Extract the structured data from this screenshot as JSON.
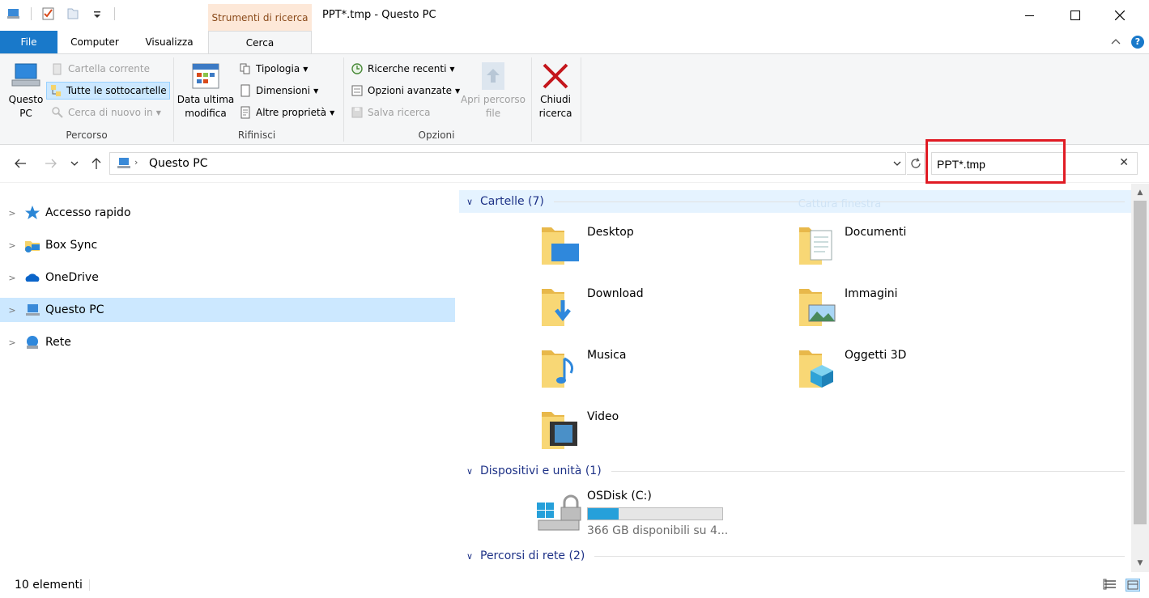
{
  "window": {
    "title": "PPT*.tmp - Questo PC",
    "context_tab_header": "Strumenti di ricerca"
  },
  "tabs": {
    "file": "File",
    "computer": "Computer",
    "visualizza": "Visualizza",
    "cerca": "Cerca"
  },
  "ribbon": {
    "percorso": {
      "label": "Percorso",
      "questo_pc": "Questo PC",
      "cartella_corrente": "Cartella corrente",
      "tutte_sottocartelle": "Tutte le sottocartelle",
      "cerca_di_nuovo": "Cerca di nuovo in"
    },
    "rifinisci": {
      "label": "Rifinisci",
      "data_ultima_modifica": "Data ultima modifica",
      "tipologia": "Tipologia",
      "dimensioni": "Dimensioni",
      "altre_proprieta": "Altre proprietà"
    },
    "opzioni": {
      "label": "Opzioni",
      "ricerche_recenti": "Ricerche recenti",
      "opzioni_avanzate": "Opzioni avanzate",
      "salva_ricerca": "Salva ricerca",
      "apri_percorso_file": "Apri percorso file"
    },
    "chiudi_ricerca": "Chiudi ricerca"
  },
  "address": {
    "crumb": "Questo PC"
  },
  "search": {
    "value": "PPT*.tmp"
  },
  "nav": {
    "items": [
      {
        "label": "Accesso rapido",
        "icon": "star-icon"
      },
      {
        "label": "Box Sync",
        "icon": "box-sync-icon"
      },
      {
        "label": "OneDrive",
        "icon": "onedrive-icon"
      },
      {
        "label": "Questo PC",
        "icon": "computer-icon",
        "selected": true
      },
      {
        "label": "Rete",
        "icon": "network-icon"
      }
    ]
  },
  "content": {
    "ghost_text": "Cattura finestra",
    "groups": {
      "cartelle": "Cartelle (7)",
      "dispositivi": "Dispositivi e unità (1)",
      "percorsi": "Percorsi di rete (2)"
    },
    "folders": [
      {
        "name": "Desktop",
        "icon": "desktop-folder-icon"
      },
      {
        "name": "Documenti",
        "icon": "documents-folder-icon"
      },
      {
        "name": "Download",
        "icon": "download-folder-icon"
      },
      {
        "name": "Immagini",
        "icon": "pictures-folder-icon"
      },
      {
        "name": "Musica",
        "icon": "music-folder-icon"
      },
      {
        "name": "Oggetti 3D",
        "icon": "3d-objects-folder-icon"
      },
      {
        "name": "Video",
        "icon": "video-folder-icon"
      }
    ],
    "drive": {
      "name": "OSDisk (C:)",
      "free_text": "366 GB disponibili su 4...",
      "used_fraction": 0.23
    }
  },
  "status": {
    "count": "10 elementi"
  },
  "colors": {
    "accent": "#1979ca",
    "selection": "#cce8ff",
    "group_header": "#1e3287",
    "highlight_box": "#e01b24"
  }
}
